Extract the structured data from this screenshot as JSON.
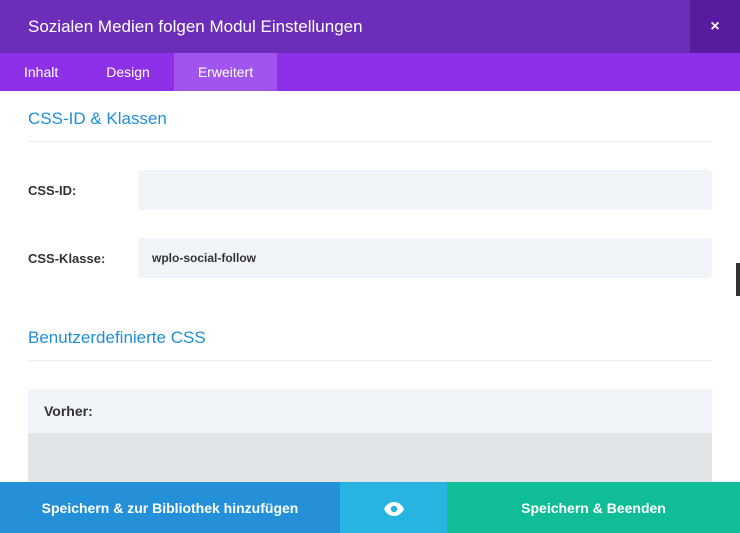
{
  "header": {
    "title": "Sozialen Medien folgen Modul Einstellungen",
    "close_label": "×"
  },
  "tabs": {
    "items": [
      {
        "label": "Inhalt"
      },
      {
        "label": "Design"
      },
      {
        "label": "Erweitert"
      }
    ]
  },
  "sections": {
    "css_id_classes": {
      "heading": "CSS-ID & Klassen",
      "css_id_label": "CSS-ID:",
      "css_id_value": "",
      "css_class_label": "CSS-Klasse:",
      "css_class_value": "wplo-social-follow"
    },
    "custom_css": {
      "heading": "Benutzerdefinierte CSS",
      "before_label": "Vorher:"
    }
  },
  "footer": {
    "save_library_label": "Speichern & zur Bibliothek hinzufügen",
    "save_exit_label": "Speichern & Beenden"
  }
}
